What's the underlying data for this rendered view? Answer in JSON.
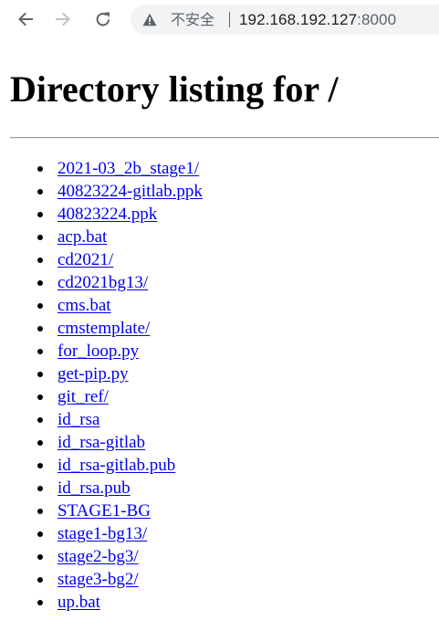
{
  "browser": {
    "security_label": "不安全",
    "url_host": "192.168.192.127",
    "url_port": ":8000"
  },
  "page": {
    "title": "Directory listing for /",
    "entries": [
      "2021-03_2b_stage1/",
      "40823224-gitlab.ppk",
      "40823224.ppk",
      "acp.bat",
      "cd2021/",
      "cd2021bg13/",
      "cms.bat",
      "cmstemplate/",
      "for_loop.py",
      "get-pip.py",
      "git_ref/",
      "id_rsa",
      "id_rsa-gitlab",
      "id_rsa-gitlab.pub",
      "id_rsa.pub",
      "STAGE1-BG",
      "stage1-bg13/",
      "stage2-bg3/",
      "stage3-bg2/",
      "up.bat"
    ]
  },
  "icons": {
    "back": "back-arrow-icon",
    "forward": "forward-arrow-icon",
    "reload": "reload-icon",
    "warning": "warning-triangle-icon"
  },
  "colors": {
    "link": "#0000ee",
    "toolbar_icon": "#5f6368",
    "forward_disabled": "#bdc1c6",
    "omnibox_bg": "#f1f3f4"
  }
}
